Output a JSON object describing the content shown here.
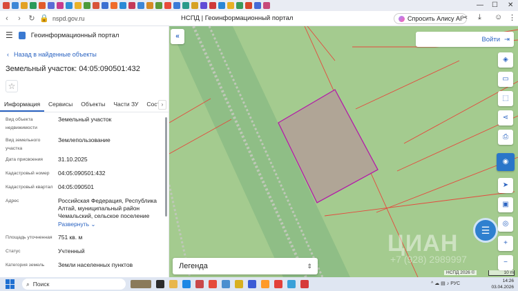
{
  "browser": {
    "url": "nspd.gov.ru",
    "tab_title": "НСПД | Геоинформационный портал",
    "alisa_label": "Спросить Алису AI",
    "tab_colors": [
      "#d84a3a",
      "#3c86d6",
      "#e2a124",
      "#2a9a5a",
      "#e25a2a",
      "#5a6bd6",
      "#c83b8c",
      "#2f8fd6",
      "#e9b227",
      "#4c9a3a",
      "#d8533a",
      "#3a6fd1",
      "#ef6b2a",
      "#2a8ad6",
      "#c43a5a",
      "#3c86d6",
      "#d68a24",
      "#5a9a3a",
      "#e84a3a",
      "#3a7ad6",
      "#2a9a8a",
      "#d6a224",
      "#5f4bd6",
      "#cf3a3a",
      "#2a86d6",
      "#e8b024",
      "#3a9a5a",
      "#d6462a",
      "#466bd6",
      "#c84a7a"
    ]
  },
  "portal": {
    "title": "Геоинформационный портал",
    "back_label": "Назад в найденные объекты",
    "object_title": "Земельный участок: 04:05:090501:432"
  },
  "tabs": [
    {
      "label": "Информация",
      "active": true
    },
    {
      "label": "Сервисы",
      "active": false
    },
    {
      "label": "Объекты",
      "active": false
    },
    {
      "label": "Части ЗУ",
      "active": false
    },
    {
      "label": "Состав",
      "active": false
    }
  ],
  "properties": [
    {
      "label": "Вид объекта недвижимости",
      "value": "Земельный участок"
    },
    {
      "label": "Вид земельного участка",
      "value": "Землепользование"
    },
    {
      "label": "Дата присвоения",
      "value": "31.10.2025"
    },
    {
      "label": "Кадастровый номер",
      "value": "04:05:090501:432"
    },
    {
      "label": "Кадастровый квартал",
      "value": "04:05:090501"
    },
    {
      "label": "Адрес",
      "value": "Российская Федерация, Республика Алтай, муниципальный район Чемальский, сельское поселение"
    },
    {
      "label": "Площадь уточненная",
      "value": "751 кв. м"
    },
    {
      "label": "Статус",
      "value": "Учтенный"
    },
    {
      "label": "Категория земель",
      "value": "Земли населенных пунктов"
    }
  ],
  "expand_label": "Развернуть",
  "map": {
    "login_label": "Войти",
    "legend_label": "Легенда",
    "copyright": "НСПД 2026 ©",
    "scale_label": "10 m",
    "watermark": "ЦИАН",
    "watermark_phone": "+7 (928) 2989997",
    "colors": {
      "base": "#a4cb8f",
      "road": "#8fbe86",
      "parcel_fill": "#b0a596",
      "parcel_stroke": "#b31aa8",
      "boundary": "#e5483c",
      "accent": "#2a76c9"
    }
  },
  "taskbar": {
    "search_label": "Поиск",
    "lang": "РУС",
    "time": "14:26",
    "date": "03.04.2026"
  }
}
